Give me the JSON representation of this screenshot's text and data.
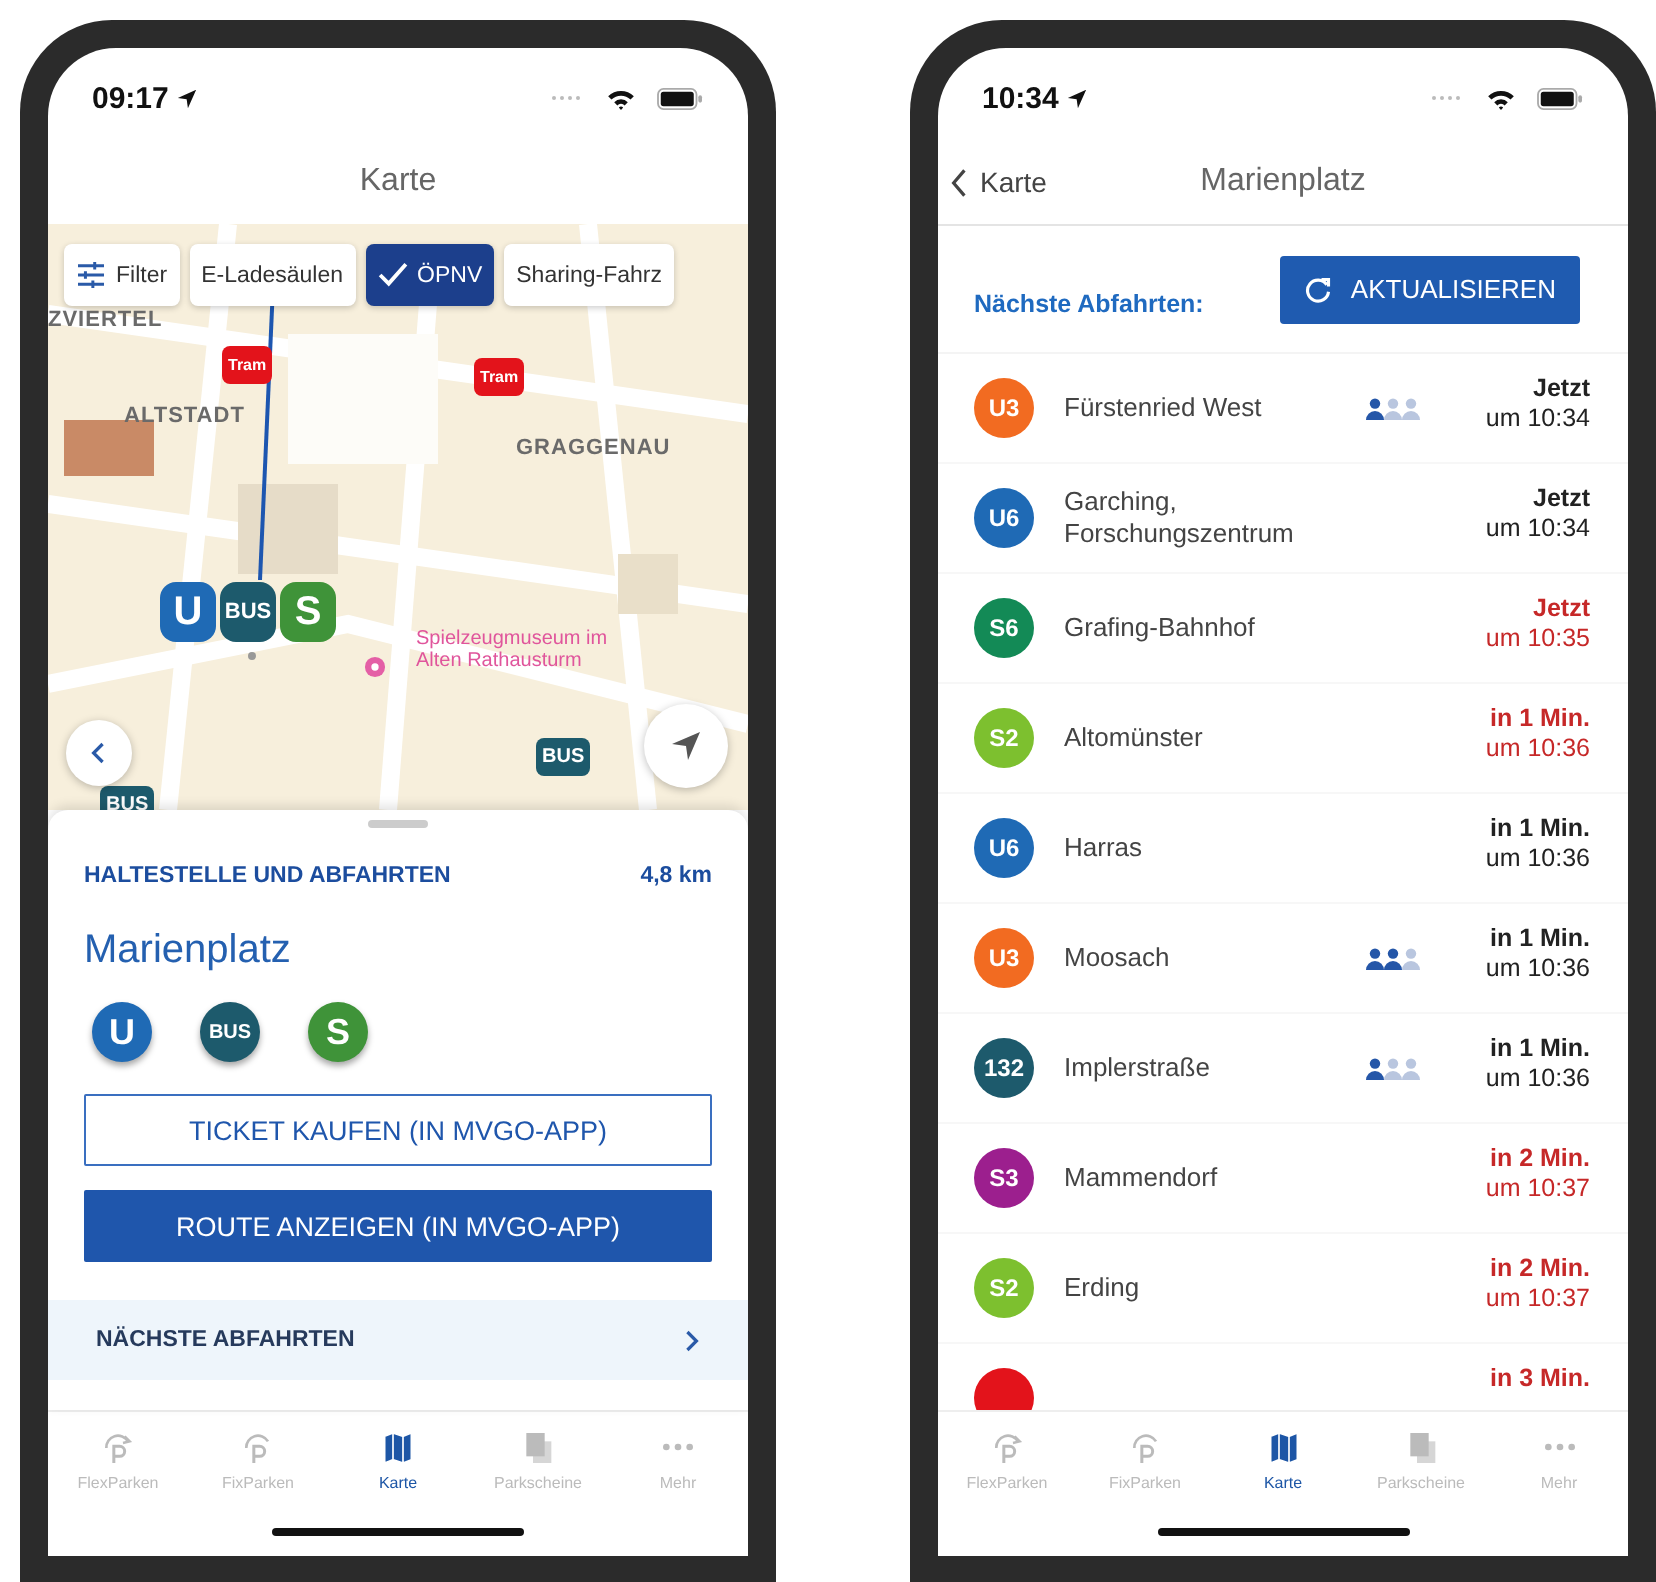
{
  "map_screen": {
    "status_bar": {
      "time": "09:17"
    },
    "nav_title": "Karte",
    "filters": [
      {
        "kind": "filter",
        "label": "Filter",
        "selected": false
      },
      {
        "kind": "chip",
        "label": "E-Ladesäulen",
        "selected": false
      },
      {
        "kind": "chip",
        "label": "ÖPNV",
        "selected": true
      },
      {
        "kind": "chip",
        "label": "Sharing-Fahrz",
        "selected": false
      }
    ],
    "map_labels": [
      {
        "kind": "district",
        "text": "ZVIERTEL"
      },
      {
        "kind": "district",
        "text": "ALTSTADT"
      },
      {
        "kind": "district",
        "text": "GRAGGENAU"
      },
      {
        "kind": "poi",
        "text": "Spielzeugmuseum im Alten Rathausturm"
      }
    ],
    "map_markers": [
      {
        "kind": "tram",
        "label": "Tram"
      },
      {
        "kind": "tram",
        "label": "Tram"
      },
      {
        "kind": "bus",
        "label": "BUS"
      },
      {
        "kind": "bus",
        "label": "BUS"
      }
    ],
    "stop_marker": [
      {
        "kind": "u",
        "label": "U"
      },
      {
        "kind": "bus",
        "label": "BUS"
      },
      {
        "kind": "s",
        "label": "S"
      }
    ],
    "sheet": {
      "heading": "HALTESTELLE UND ABFAHRTEN",
      "distance": "4,8 km",
      "stop_name": "Marienplatz",
      "modes": [
        {
          "kind": "u",
          "label": "U"
        },
        {
          "kind": "bus",
          "label": "BUS"
        },
        {
          "kind": "s",
          "label": "S"
        }
      ],
      "buttons": [
        {
          "kind": "outline",
          "label": "TICKET KAUFEN (IN MVGO-APP)"
        },
        {
          "kind": "primary",
          "label": "ROUTE ANZEIGEN (IN MVGO-APP)"
        }
      ],
      "link": "NÄCHSTE ABFAHRTEN"
    },
    "tab_bar": [
      {
        "kind": "flex",
        "label": "FlexParken",
        "selected": false
      },
      {
        "kind": "fix",
        "label": "FixParken",
        "selected": false
      },
      {
        "kind": "map",
        "label": "Karte",
        "selected": true
      },
      {
        "kind": "tickets",
        "label": "Parkscheine",
        "selected": false
      },
      {
        "kind": "more",
        "label": "Mehr",
        "selected": false
      }
    ]
  },
  "departures_screen": {
    "status_bar": {
      "time": "10:34"
    },
    "back_label": "Karte",
    "nav_title": "Marienplatz",
    "heading": "Nächste Abfahrten:",
    "refresh_button": "AKTUALISIEREN",
    "departures": [
      {
        "line": "U3",
        "color": "#f26b21",
        "destination": "Fürstenried West",
        "level": 0.33,
        "relative": "Jetzt",
        "time": "um 10:34",
        "delayed": false
      },
      {
        "line": "U6",
        "color": "#1f6ab5",
        "destination": "Garching, Forschungszentrum",
        "relative": "Jetzt",
        "time": "um 10:34",
        "delayed": false
      },
      {
        "line": "S6",
        "color": "#138a56",
        "destination": "Grafing-Bahnhof",
        "relative": "Jetzt",
        "time": "um 10:35",
        "delayed": true
      },
      {
        "line": "S2",
        "color": "#7dc02f",
        "destination": "Altomünster",
        "relative": "in 1 Min.",
        "time": "um 10:36",
        "delayed": true
      },
      {
        "line": "U6",
        "color": "#1f6ab5",
        "destination": "Harras",
        "relative": "in 1 Min.",
        "time": "um 10:36",
        "delayed": false
      },
      {
        "line": "U3",
        "color": "#f26b21",
        "destination": "Moosach",
        "level": 0.67,
        "relative": "in 1 Min.",
        "time": "um 10:36",
        "delayed": false
      },
      {
        "line": "132",
        "color": "#1d5a6c",
        "destination": "Implerstraße",
        "level": 0.33,
        "relative": "in 1 Min.",
        "time": "um 10:36",
        "delayed": false
      },
      {
        "line": "S3",
        "color": "#9c1f8e",
        "destination": "Mammendorf",
        "relative": "in 2 Min.",
        "time": "um 10:37",
        "delayed": true
      },
      {
        "line": "S2",
        "color": "#7dc02f",
        "destination": "Erding",
        "relative": "in 2 Min.",
        "time": "um 10:37",
        "delayed": true
      },
      {
        "color": "#e3131b",
        "relative": "in 3 Min.",
        "delayed": true
      }
    ],
    "tab_bar": [
      {
        "kind": "flex",
        "label": "FlexParken",
        "selected": false
      },
      {
        "kind": "fix",
        "label": "FixParken",
        "selected": false
      },
      {
        "kind": "map",
        "label": "Karte",
        "selected": true
      },
      {
        "kind": "tickets",
        "label": "Parkscheine",
        "selected": false
      },
      {
        "kind": "more",
        "label": "Mehr",
        "selected": false
      }
    ]
  }
}
